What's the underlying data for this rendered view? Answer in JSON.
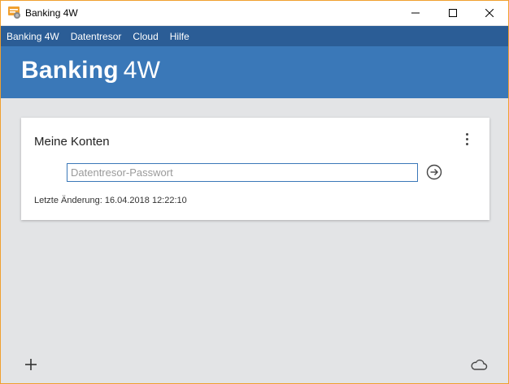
{
  "window": {
    "title": "Banking 4W",
    "app_icon": "banking-app-icon",
    "controls": [
      "minimize-icon",
      "maximize-icon",
      "close-icon"
    ]
  },
  "menu": {
    "items": [
      "Banking 4W",
      "Datentresor",
      "Cloud",
      "Hilfe"
    ]
  },
  "header": {
    "brand_bold": "Banking",
    "brand_light": "4W"
  },
  "card": {
    "title": "Meine Konten",
    "password_placeholder": "Datentresor-Passwort",
    "password_value": "",
    "last_change": "Letzte Änderung: 16.04.2018 12:22:10",
    "menu_icon": "more-vertical-icon",
    "submit_icon": "arrow-right-circle-icon"
  },
  "footer": {
    "add_icon": "plus-icon",
    "cloud_icon": "cloud-icon"
  },
  "colors": {
    "menubar": "#2b5d96",
    "header": "#3a78b8",
    "background": "#e3e4e6",
    "window_border": "#f0a030",
    "input_border": "#3a78b8"
  }
}
